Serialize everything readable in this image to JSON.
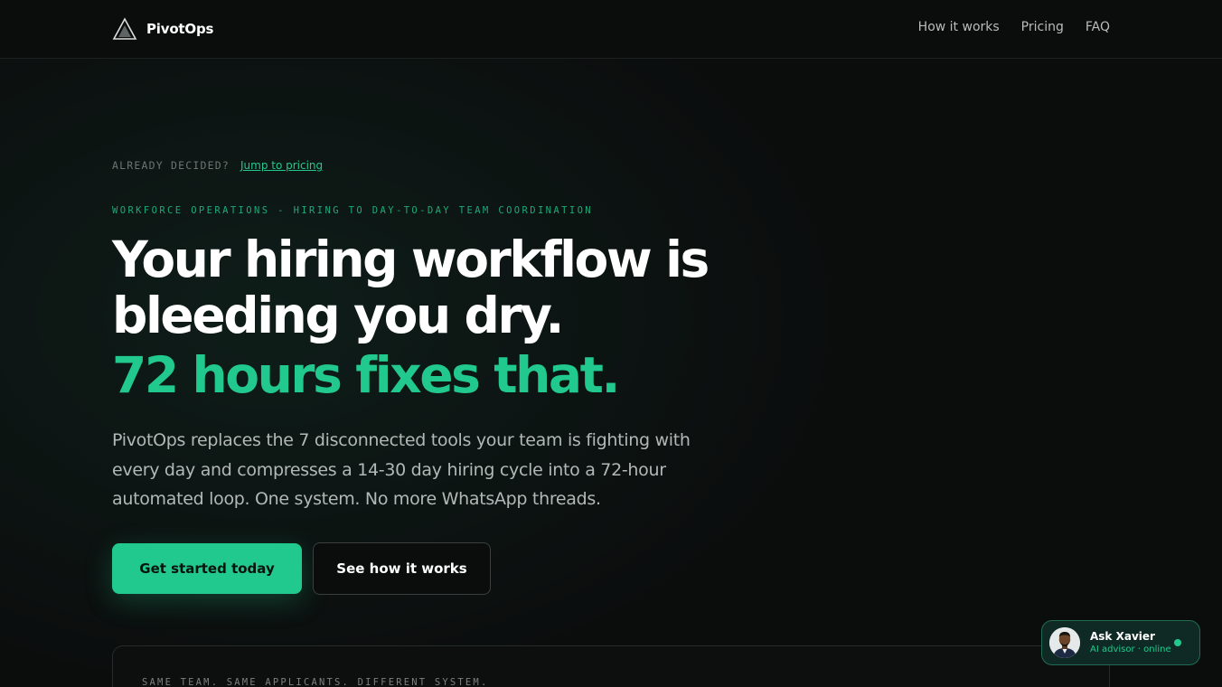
{
  "header": {
    "brand": "PivotOps",
    "nav": [
      {
        "label": "How it works"
      },
      {
        "label": "Pricing"
      },
      {
        "label": "FAQ"
      }
    ]
  },
  "hero": {
    "pre_label": "ALREADY DECIDED?",
    "pre_link": "Jump to pricing",
    "eyebrow": "WORKFORCE OPERATIONS - HIRING TO DAY-TO-DAY TEAM COORDINATION",
    "headline_line1": "Your hiring workflow is",
    "headline_line2": "bleeding you dry.",
    "headline_accent": "72 hours fixes that.",
    "subcopy": "PivotOps replaces the 7 disconnected tools your team is fighting with every day and compresses a 14-30 day hiring cycle into a 72-hour automated loop. One system. No more WhatsApp threads.",
    "primary_cta": "Get started today",
    "secondary_cta": "See how it works"
  },
  "compare": {
    "label": "SAME TEAM. SAME APPLICANTS. DIFFERENT SYSTEM."
  },
  "chat": {
    "name": "Ask Xavier",
    "status": "AI advisor · online"
  },
  "colors": {
    "accent": "#22c98f",
    "background": "#0b0d0d"
  }
}
